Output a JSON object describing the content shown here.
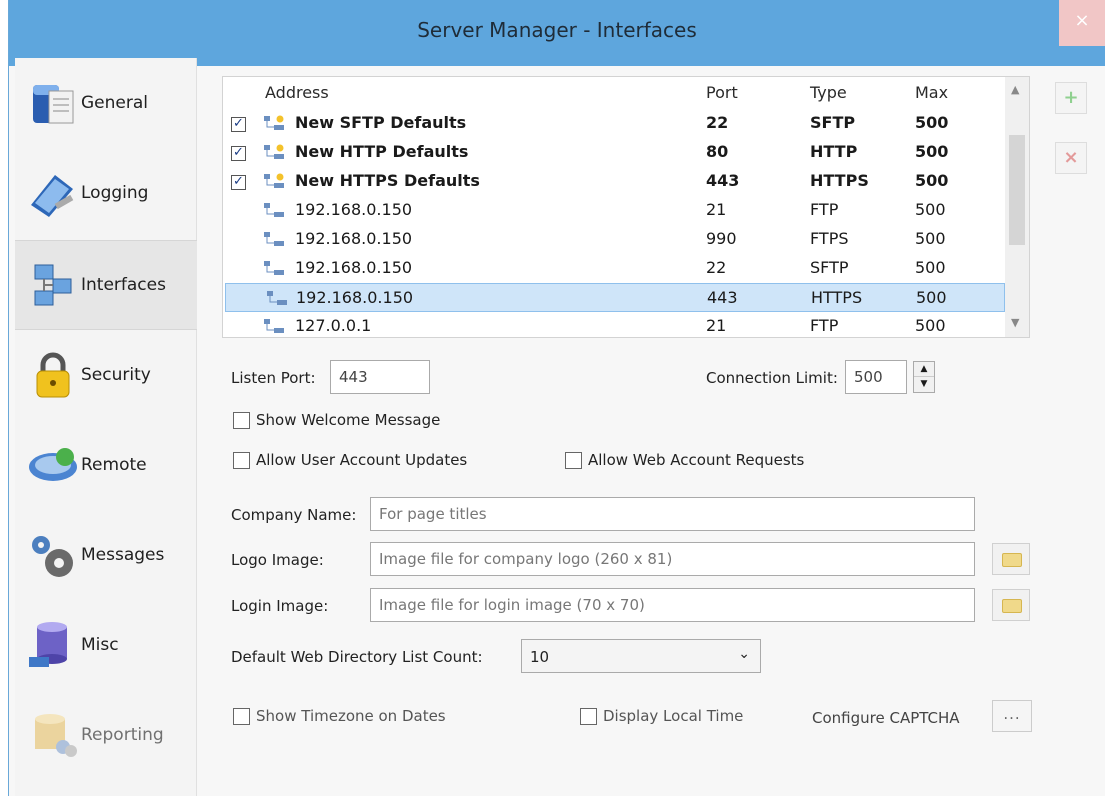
{
  "window": {
    "title": "Server Manager - Interfaces",
    "close_glyph": "×"
  },
  "nav": [
    {
      "label": "General",
      "icon": "general-icon"
    },
    {
      "label": "Logging",
      "icon": "logging-icon"
    },
    {
      "label": "Interfaces",
      "icon": "interfaces-icon",
      "selected": true
    },
    {
      "label": "Security",
      "icon": "padlock-icon"
    },
    {
      "label": "Remote",
      "icon": "remote-icon"
    },
    {
      "label": "Messages",
      "icon": "gears-icon"
    },
    {
      "label": "Misc",
      "icon": "database-icon"
    },
    {
      "label": "Reporting",
      "icon": "reporting-icon",
      "disabled": true
    }
  ],
  "grid": {
    "columns": [
      "Address",
      "Port",
      "Type",
      "Max"
    ],
    "rows": [
      {
        "checked": true,
        "address": "New SFTP Defaults",
        "port": "22",
        "type": "SFTP",
        "max": "500",
        "bold": true
      },
      {
        "checked": true,
        "address": "New HTTP Defaults",
        "port": "80",
        "type": "HTTP",
        "max": "500",
        "bold": true
      },
      {
        "checked": true,
        "address": "New HTTPS Defaults",
        "port": "443",
        "type": "HTTPS",
        "max": "500",
        "bold": true
      },
      {
        "address": "192.168.0.150",
        "port": "21",
        "type": "FTP",
        "max": "500"
      },
      {
        "address": "192.168.0.150",
        "port": "990",
        "type": "FTPS",
        "max": "500"
      },
      {
        "address": "192.168.0.150",
        "port": "22",
        "type": "SFTP",
        "max": "500"
      },
      {
        "address": "192.168.0.150",
        "port": "443",
        "type": "HTTPS",
        "max": "500",
        "selected": true
      },
      {
        "address": "127.0.0.1",
        "port": "21",
        "type": "FTP",
        "max": "500"
      }
    ],
    "check_glyph": "✓"
  },
  "side_buttons": {
    "add": "+",
    "remove": "×"
  },
  "form": {
    "listen_port_label": "Listen Port:",
    "listen_port_value": "443",
    "connection_limit_label": "Connection Limit:",
    "connection_limit_value": "500",
    "spin_up": "▲",
    "spin_down": "▼",
    "show_welcome": "Show Welcome Message",
    "allow_user_updates": "Allow User Account Updates",
    "allow_web_requests": "Allow Web Account Requests",
    "company_name_label": "Company Name:",
    "company_name_placeholder": "For page titles",
    "logo_image_label": "Logo Image:",
    "logo_image_placeholder": "Image file for company logo (260 x 81)",
    "login_image_label": "Login Image:",
    "login_image_placeholder": "Image file for login image (70 x 70)",
    "dir_count_label": "Default Web Directory List Count:",
    "dir_count_value": "10",
    "show_timezone": "Show Timezone on Dates",
    "display_local_time": "Display Local Time",
    "configure_captcha": "Configure CAPTCHA",
    "captcha_button": "..."
  }
}
